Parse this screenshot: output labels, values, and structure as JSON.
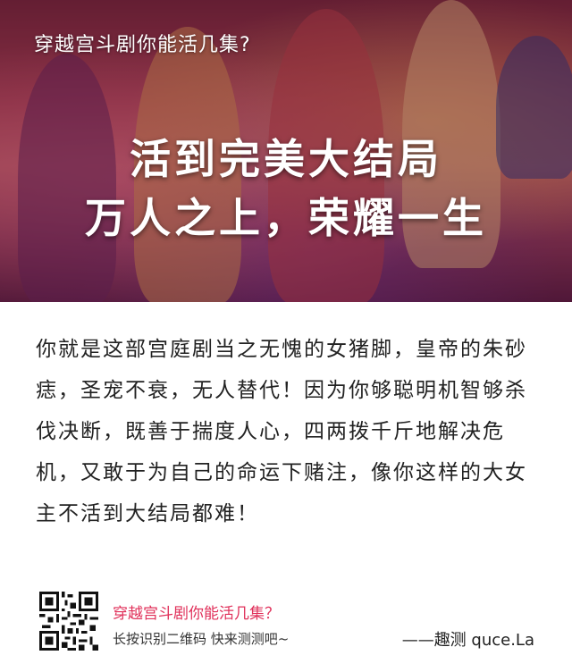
{
  "hero": {
    "question": "穿越宫斗剧你能活几集?",
    "title_line1": "活到完美大结局",
    "title_line2": "万人之上，荣耀一生"
  },
  "description": "你就是这部宫庭剧当之无愧的女猪脚，皇帝的朱砂痣，圣宠不衰，无人替代！因为你够聪明机智够杀伐决断，既善于揣度人心，四两拨千斤地解决危机，又敢于为自己的命运下赌注，像你这样的大女主不活到大结局都难！",
  "footer": {
    "title": "穿越宫斗剧你能活几集？",
    "subtitle": "长按识别二维码   快来测测吧~",
    "brand": "——趣测 quce.La",
    "qr_icon": "qr-code-icon"
  },
  "colors": {
    "accent": "#e0305a",
    "text": "#222222"
  }
}
